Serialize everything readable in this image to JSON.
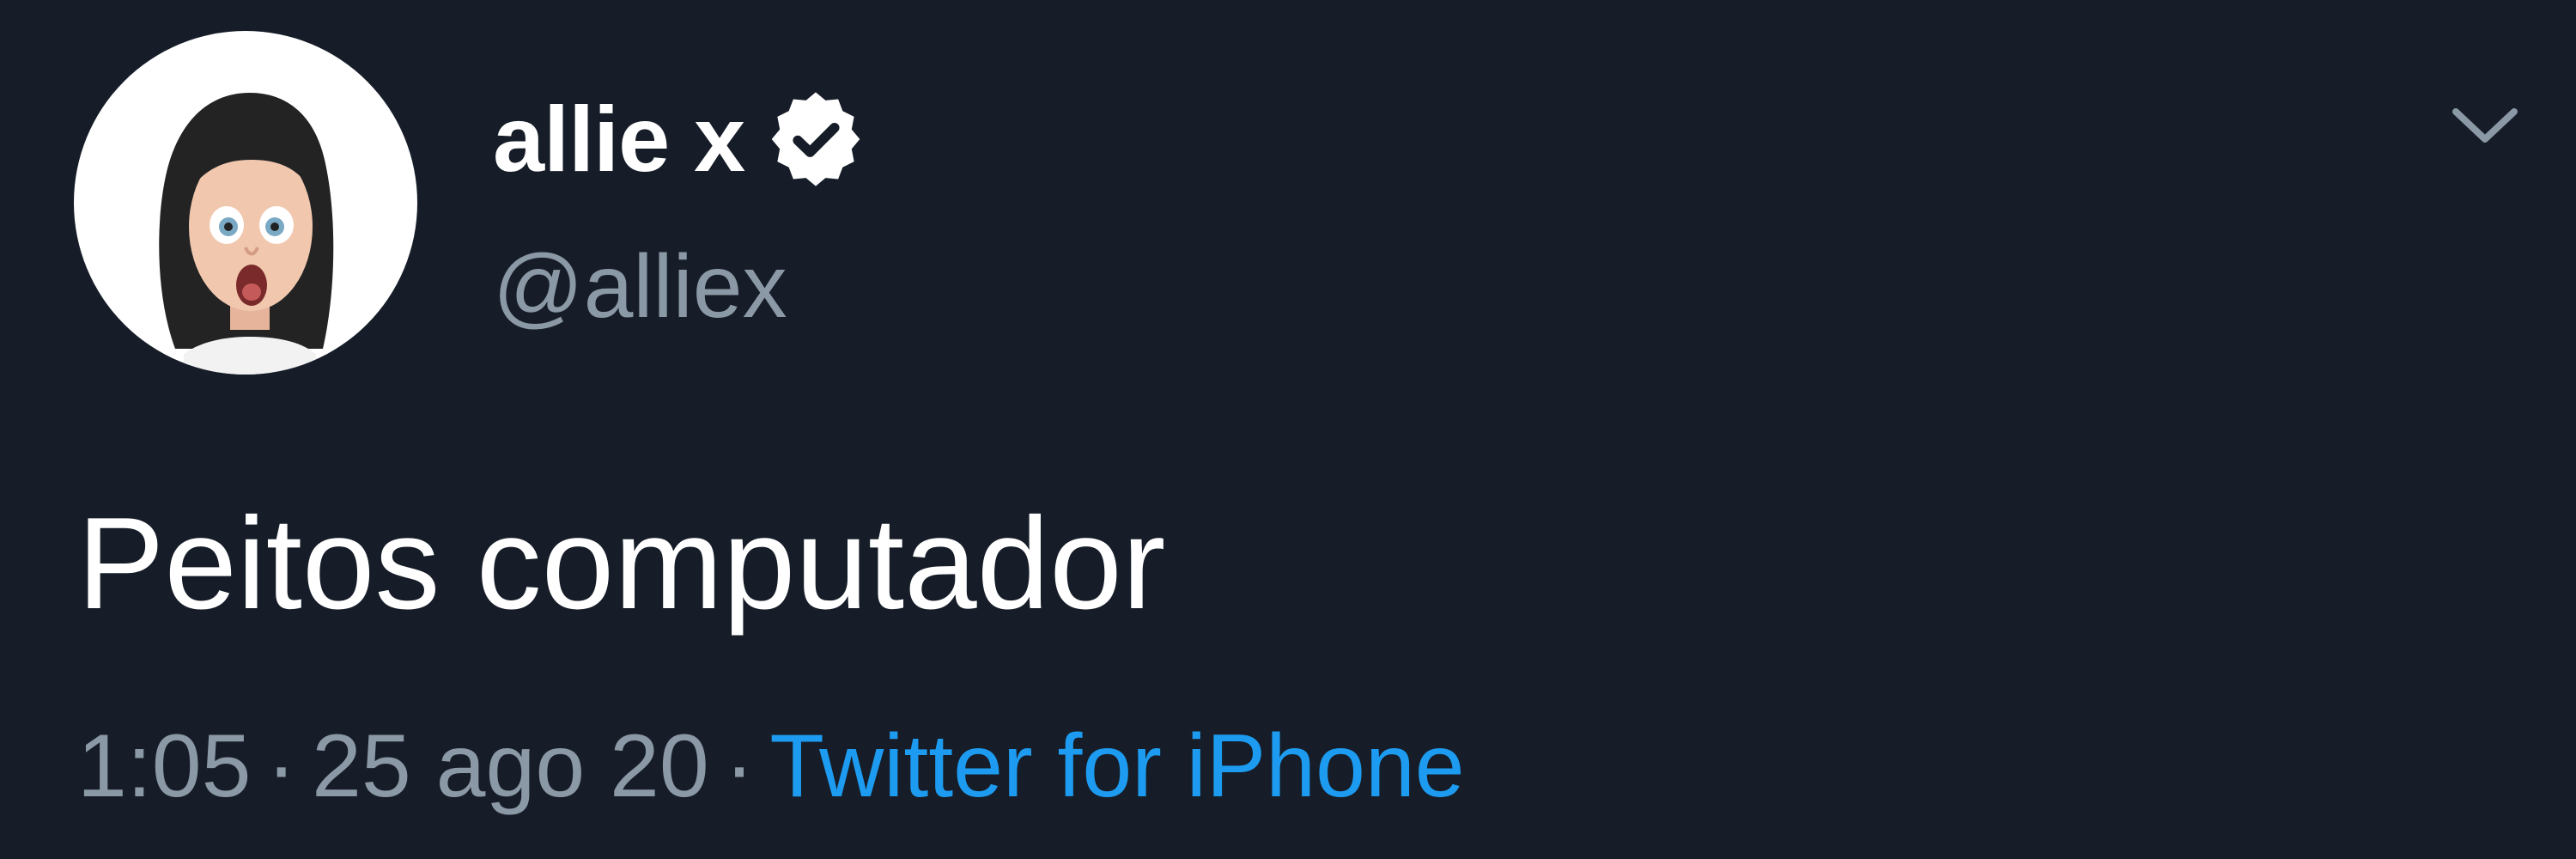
{
  "tweet": {
    "author": {
      "display_name": "allie x",
      "handle": "@alliex",
      "verified": true,
      "avatar_icon": "memoji-avatar"
    },
    "text": "Peitos computador",
    "meta": {
      "time": "1:05",
      "separator": "·",
      "date": "25 ago 20",
      "source": "Twitter for iPhone"
    },
    "menu_icon": "chevron-down-icon"
  },
  "colors": {
    "background": "#161d28",
    "text_primary": "#ffffff",
    "text_secondary": "#8b98a5",
    "link": "#1d9bf0"
  }
}
